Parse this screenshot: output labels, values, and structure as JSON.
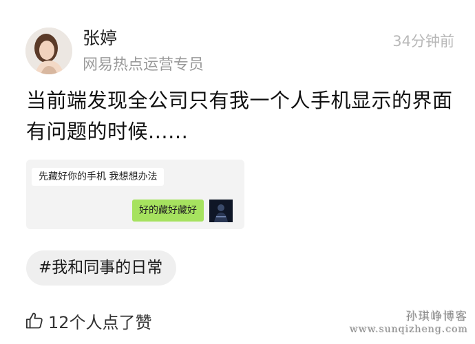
{
  "post": {
    "author": {
      "name": "张婷",
      "title": "网易热点运营专员"
    },
    "time": "34分钟前",
    "text": "当前端发现全公司只有我一个人手机显示的界面有问题的时候......",
    "image": {
      "messages": [
        {
          "side": "left",
          "text": "先藏好你的手机 我想想办法"
        },
        {
          "side": "right",
          "text": "好的藏好藏好"
        }
      ]
    },
    "topic": "#我和同事的日常",
    "likes": "12个人点了赞"
  },
  "watermark": {
    "line1": "孙琪峥博客",
    "line2": "www.sunqizheng.com"
  },
  "colors": {
    "accent_bubble": "#a6e25f",
    "muted_text": "#9a9a9a",
    "tag_bg": "#efefef"
  },
  "icons": {
    "avatar": "woman-portrait-photo",
    "like": "thumbs-up-icon"
  }
}
